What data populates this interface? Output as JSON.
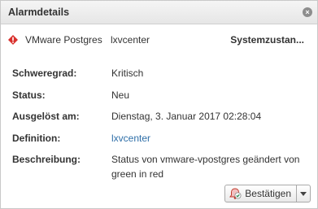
{
  "window": {
    "title": "Alarmdetails",
    "close_symbol": "×"
  },
  "alarm": {
    "icon": "alert-icon",
    "name": "VMware Postgres",
    "target": "lxvcenter",
    "status_link": "Systemzustan..."
  },
  "details": {
    "severity_label": "Schweregrad:",
    "severity_value": "Kritisch",
    "status_label": "Status:",
    "status_value": "Neu",
    "triggered_label": "Ausgelöst am:",
    "triggered_value": "Dienstag, 3. Januar 2017 02:28:04",
    "definition_label": "Definition:",
    "definition_value": "lxvcenter",
    "description_label": "Beschreibung:",
    "description_value": "Status von vmware-vpostgres geändert von green in red"
  },
  "actions": {
    "acknowledge_label": "Bestätigen",
    "acknowledge_icon": "acknowledge-alarm-icon",
    "dropdown_icon": "chevron-down-icon"
  },
  "colors": {
    "critical": "#d9302c",
    "link": "#2f6fa8",
    "titlebar": "#e9e9e9"
  }
}
